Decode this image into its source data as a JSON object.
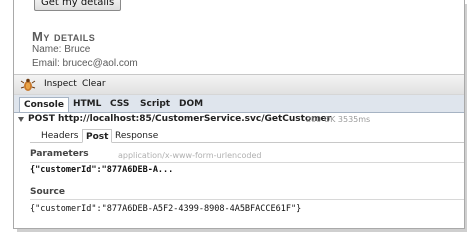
{
  "page": {
    "button_label": "Get my details",
    "heading": "My details",
    "name_line": "Name: Bruce",
    "email_line": "Email: brucec@aol.com"
  },
  "toolbar": {
    "inspect_label": "Inspect",
    "clear_label": "Clear"
  },
  "tabs": [
    "Console",
    "HTML",
    "CSS",
    "Script",
    "DOM"
  ],
  "request": {
    "line": "POST http://localhost:85/CustomerService.svc/GetCustomer",
    "status": "200 OK 3535ms"
  },
  "subtabs": [
    "Headers",
    "Post",
    "Response"
  ],
  "parameters": {
    "label": "Parameters",
    "content_type": "application/x-www-form-urlencoded",
    "value": "{\"customerId\":\"877A6DEB-A..."
  },
  "source": {
    "label": "Source",
    "value": "{\"customerId\":\"877A6DEB-A5F2-4399-8908-4A5BFACCE61F\"}"
  },
  "colors": {
    "tab_bar": "#dfe5ed",
    "heading": "#5a5a5a"
  }
}
